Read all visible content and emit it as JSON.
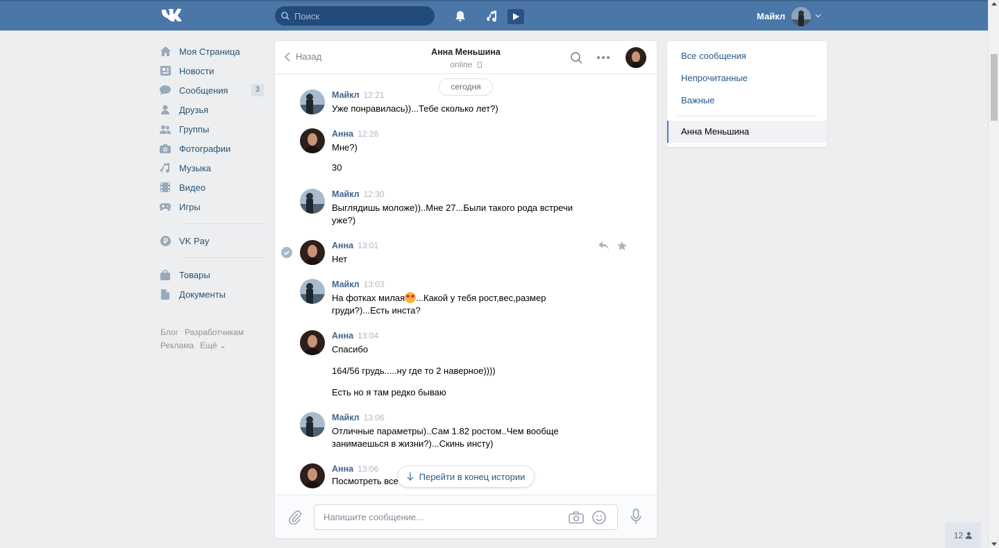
{
  "topbar": {
    "search_placeholder": "Поиск",
    "user_name": "Майкл"
  },
  "sidebar": {
    "items": [
      {
        "label": "Моя Страница",
        "icon": "home-icon"
      },
      {
        "label": "Новости",
        "icon": "news-icon"
      },
      {
        "label": "Сообщения",
        "icon": "messages-icon",
        "badge": "3"
      },
      {
        "label": "Друзья",
        "icon": "friends-icon"
      },
      {
        "label": "Группы",
        "icon": "groups-icon"
      },
      {
        "label": "Фотографии",
        "icon": "photos-icon"
      },
      {
        "label": "Музыка",
        "icon": "music-icon"
      },
      {
        "label": "Видео",
        "icon": "video-icon"
      },
      {
        "label": "Игры",
        "icon": "games-icon"
      }
    ],
    "vkpay": "VK Pay",
    "items2": [
      {
        "label": "Товары",
        "icon": "market-icon"
      },
      {
        "label": "Документы",
        "icon": "documents-icon"
      }
    ],
    "footer": {
      "blog": "Блог",
      "dev": "Разработчикам",
      "ads": "Реклама",
      "more": "Ещё"
    }
  },
  "chat": {
    "back": "Назад",
    "contact_name": "Анна Меньшина",
    "status": "online",
    "date_chip": "сегодня",
    "messages": [
      {
        "author": "Майкл",
        "time": "12:21",
        "lines": [
          "Уже понравилась))...Тебе сколько лет?)"
        ]
      },
      {
        "author": "Анна",
        "time": "12:26",
        "lines": [
          "Мне?)",
          "30"
        ]
      },
      {
        "author": "Майкл",
        "time": "12:30",
        "lines": [
          "Выглядишь моложе))..Мне 27...Были такого рода встречи уже?)"
        ]
      },
      {
        "author": "Анна",
        "time": "13:01",
        "lines": [
          "Нет"
        ]
      },
      {
        "author": "Майкл",
        "time": "13:03",
        "lines": [
          "На фотках милая",
          "...Какой у тебя рост,вес,размер груди?)...Есть инста?"
        ]
      },
      {
        "author": "Анна",
        "time": "13:04",
        "lines": [
          "Спасибо",
          "164/56 грудь.....ну где то 2 наверное))))",
          "Есть но я там редко бываю"
        ]
      },
      {
        "author": "Майкл",
        "time": "13:06",
        "lines": [
          "Отличные параметры)..Сам 1.82 ростом..Чем вообще занимаешься в жизни?)...Скинь инсту)"
        ]
      },
      {
        "author": "Анна",
        "time": "13:06",
        "lines": [
          "Посмотреть все"
        ]
      }
    ],
    "jump_label": "Перейти в конец истории",
    "composer_placeholder": "Напишите сообщение..."
  },
  "right_panel": {
    "all": "Все сообщения",
    "unread": "Непрочитанные",
    "important": "Важные",
    "active": "Анна Меньшина"
  },
  "online_counter": "12",
  "colors": {
    "accent": "#4a76a8",
    "link": "#2a5885",
    "background": "#edeef0"
  }
}
